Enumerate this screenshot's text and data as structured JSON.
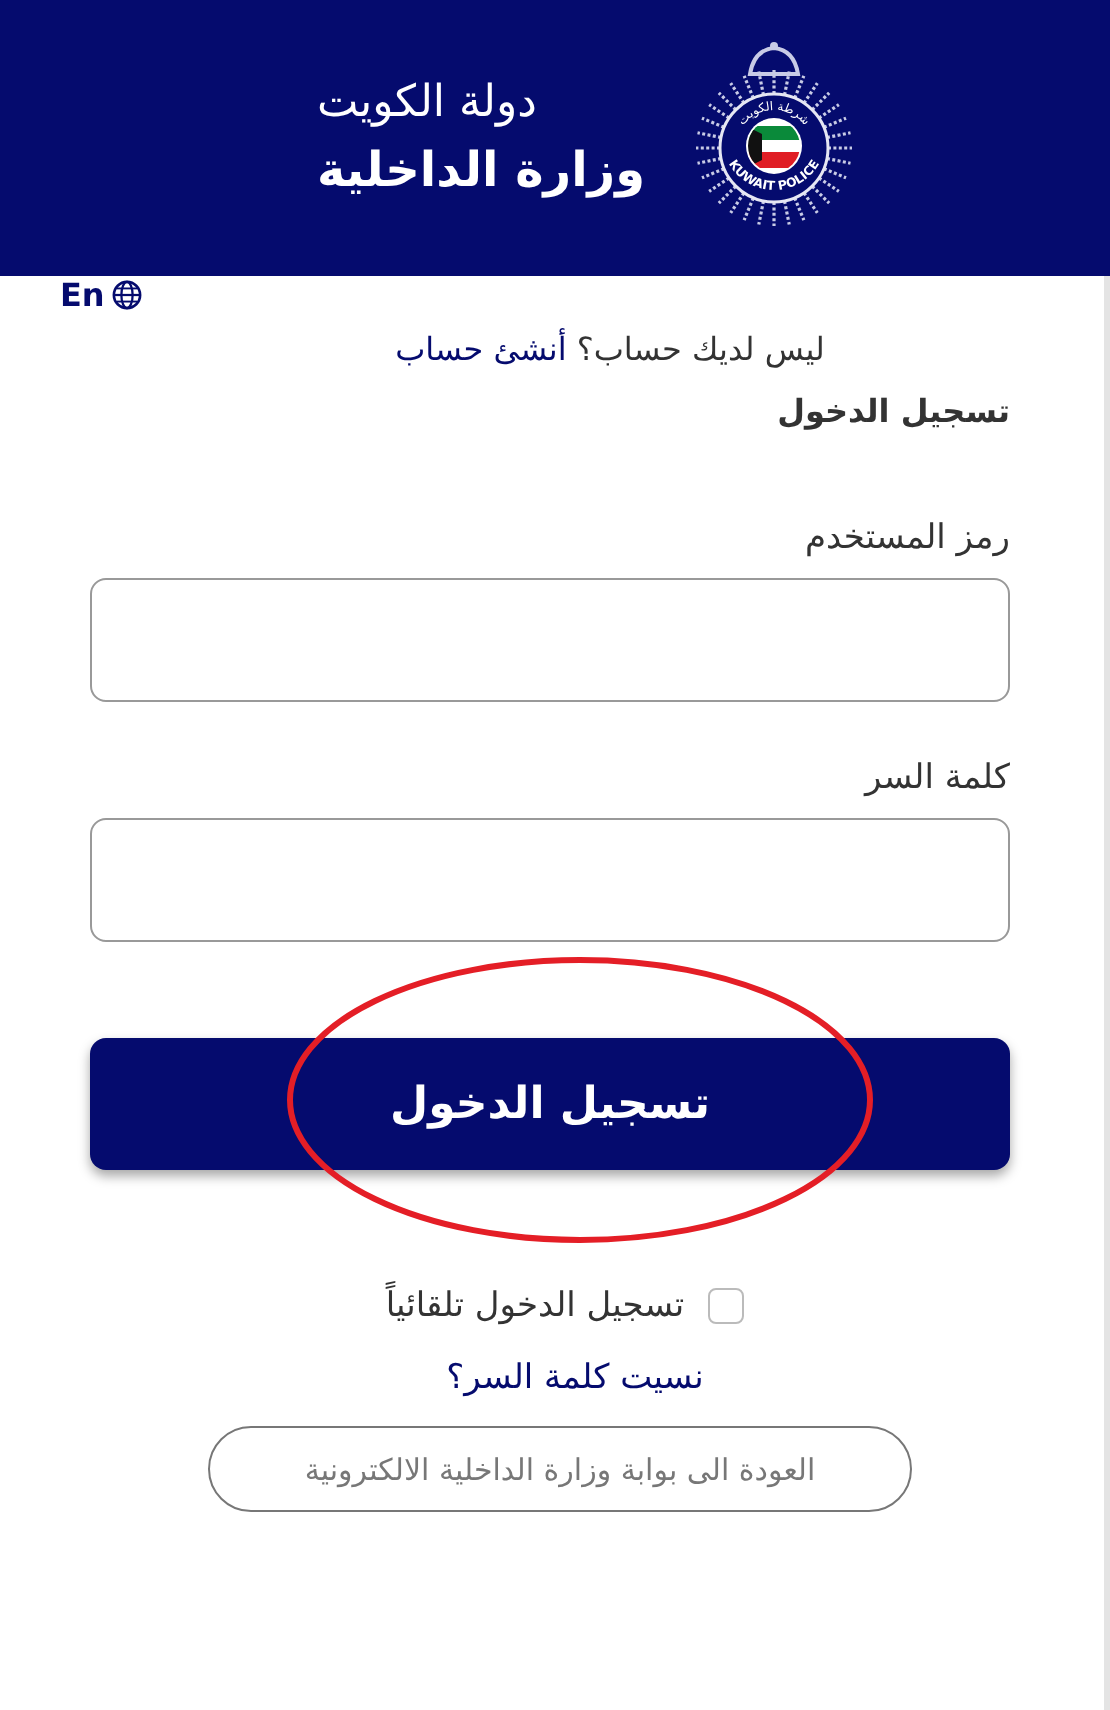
{
  "header": {
    "line_1": "دولة الكويت",
    "line_2": "وزارة الداخلية",
    "badge_text_top": "شرطة الكويت",
    "badge_text_bottom": "KUWAIT POLICE"
  },
  "language_link": "En",
  "signup_prompt": {
    "question": "ليس لديك حساب؟",
    "link": "أنشئ حساب"
  },
  "form_title": "تسجيل الدخول",
  "fields": [
    {
      "label": "رمز المستخدم"
    },
    {
      "label": "كلمة السر"
    }
  ],
  "login_button": "تسجيل الدخول",
  "remember_me": {
    "label": "تسجيل الدخول تلقائياً",
    "checked": false
  },
  "forgot_password": "نسيت كلمة السر؟",
  "back_button": "العودة الى بوابة وزارة الداخلية الالكترونية"
}
